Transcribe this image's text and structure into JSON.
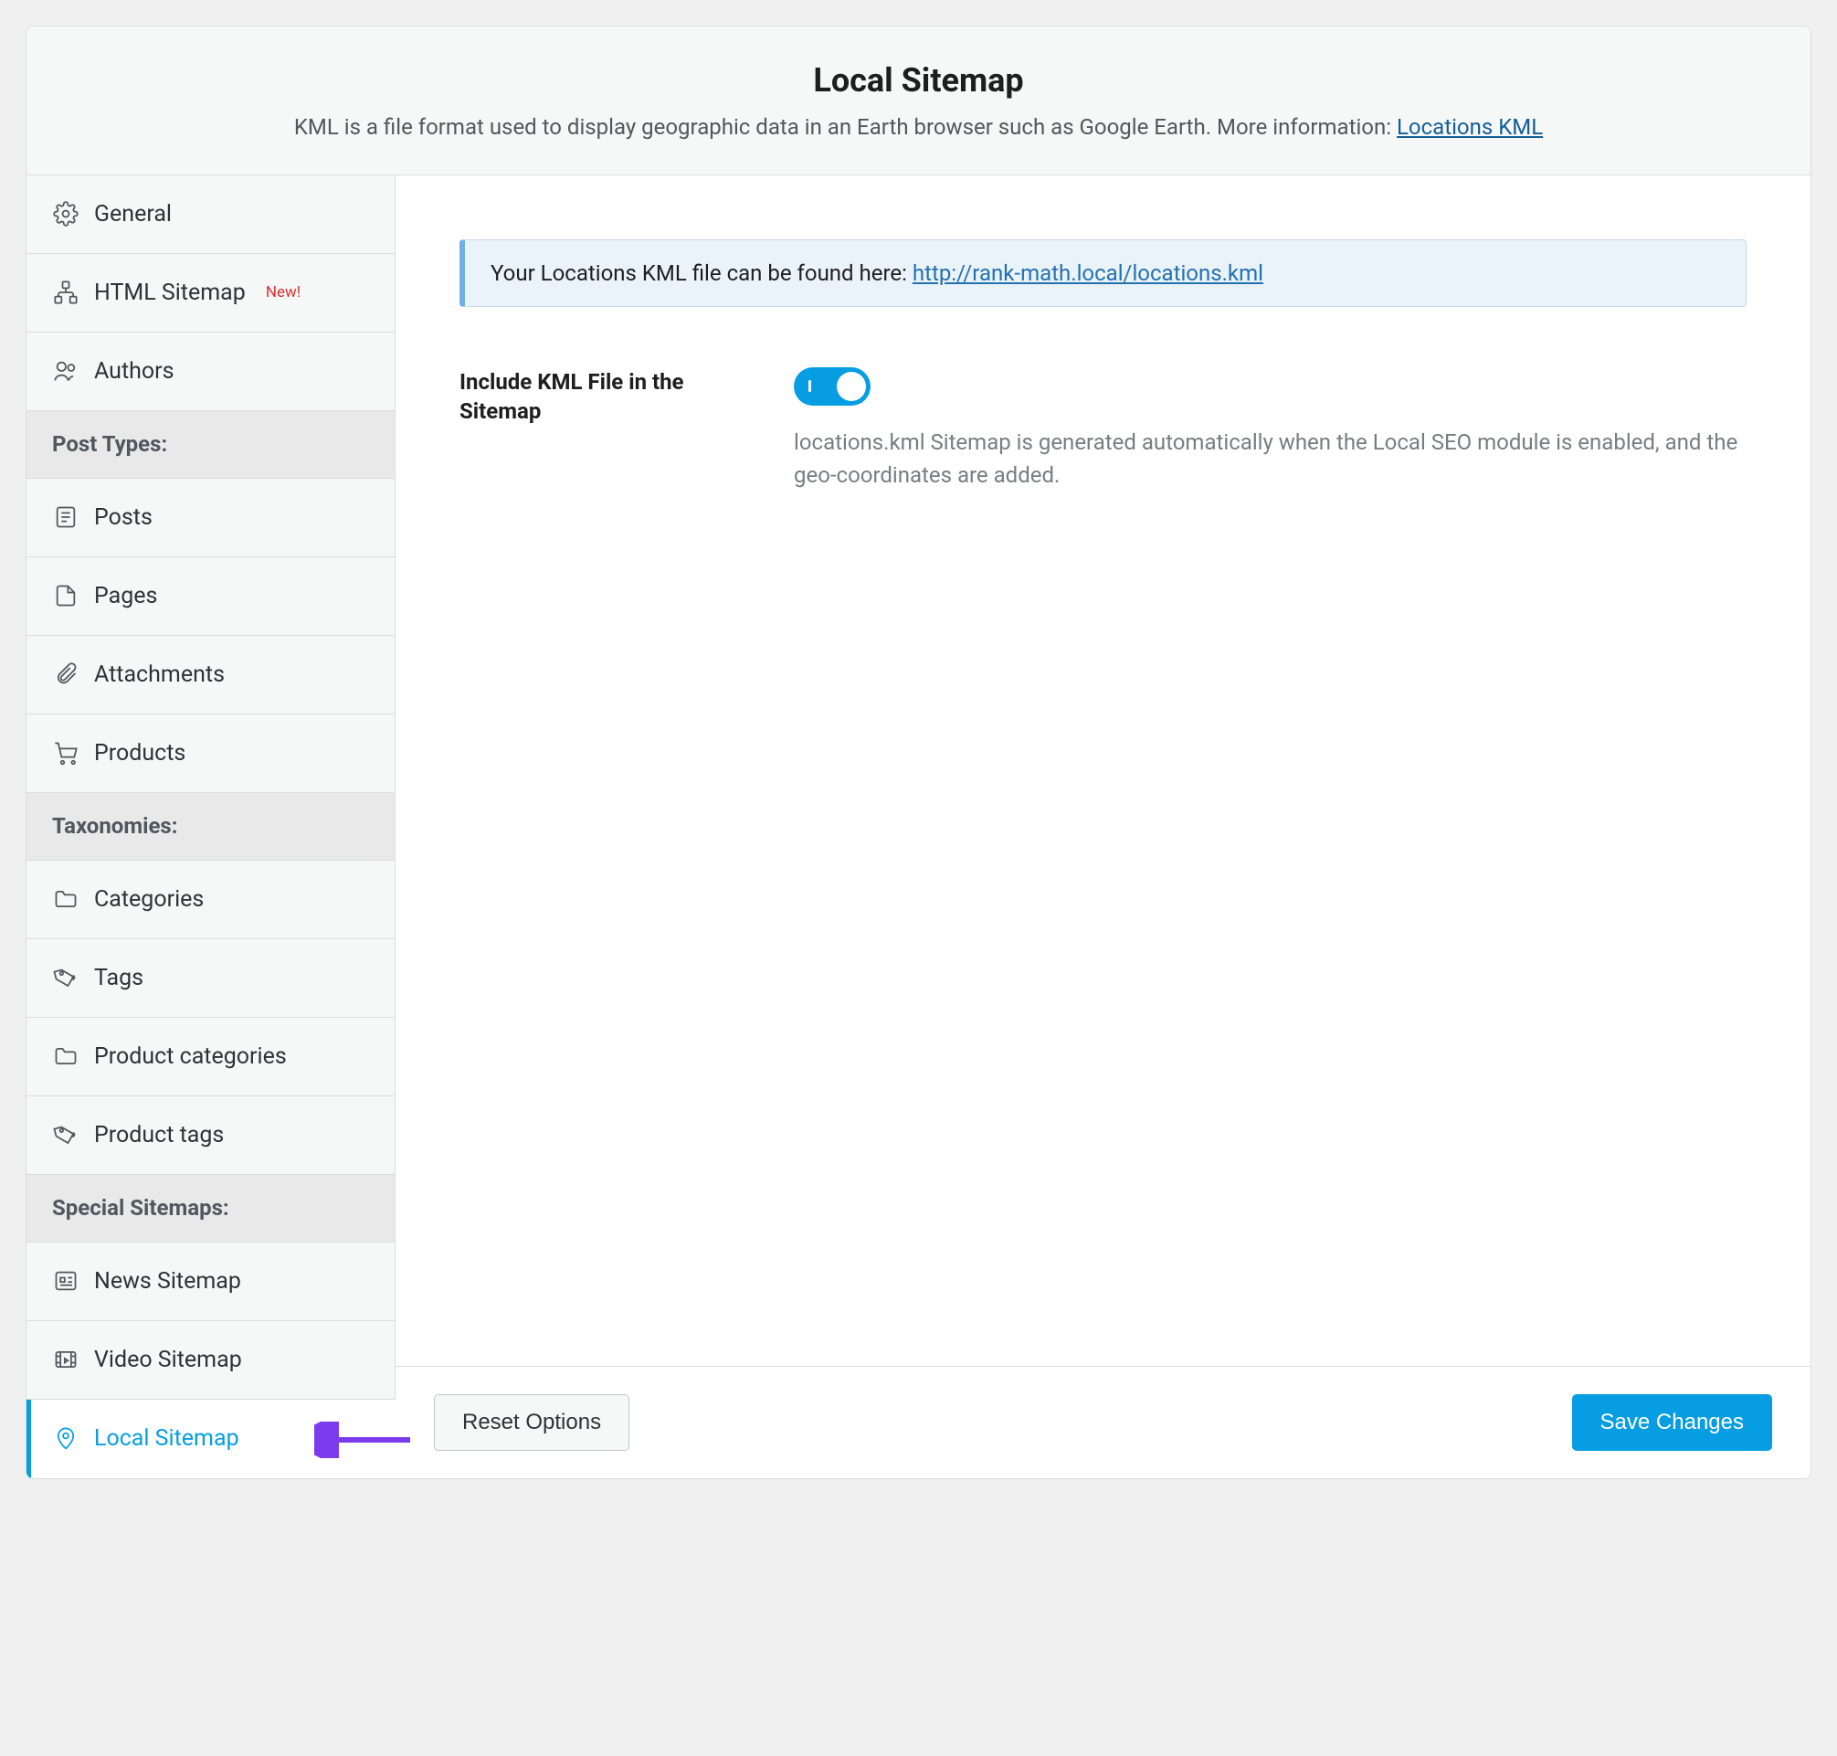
{
  "header": {
    "title": "Local Sitemap",
    "description_prefix": "KML is a file format used to display geographic data in an Earth browser such as Google Earth. More information: ",
    "description_link": "Locations KML"
  },
  "sidebar": {
    "items_top": [
      {
        "label": "General"
      },
      {
        "label": "HTML Sitemap",
        "badge": "New!"
      },
      {
        "label": "Authors"
      }
    ],
    "section_post_types": "Post Types:",
    "items_post_types": [
      {
        "label": "Posts"
      },
      {
        "label": "Pages"
      },
      {
        "label": "Attachments"
      },
      {
        "label": "Products"
      }
    ],
    "section_taxonomies": "Taxonomies:",
    "items_taxonomies": [
      {
        "label": "Categories"
      },
      {
        "label": "Tags"
      },
      {
        "label": "Product categories"
      },
      {
        "label": "Product tags"
      }
    ],
    "section_special": "Special Sitemaps:",
    "items_special": [
      {
        "label": "News Sitemap"
      },
      {
        "label": "Video Sitemap"
      },
      {
        "label": "Local Sitemap"
      }
    ]
  },
  "notice": {
    "text_prefix": "Your Locations KML file can be found here: ",
    "link": "http://rank-math.local/locations.kml"
  },
  "settings": {
    "include_kml": {
      "label": "Include KML File in the Sitemap",
      "description": "locations.kml Sitemap is generated automatically when the Local SEO module is enabled, and the geo-coordinates are added."
    }
  },
  "footer": {
    "reset": "Reset Options",
    "save": "Save Changes"
  }
}
